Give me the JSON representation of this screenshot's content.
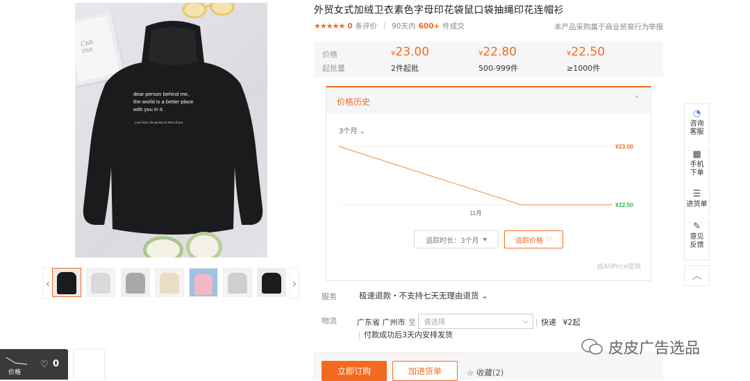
{
  "product": {
    "title": "外贸女式加绒卫衣素色字母印花袋鼠口袋抽绳印花连帽衫",
    "print_text": "dear person behind me,\nthe world is a better place\nwith you in it.",
    "print_small": "Love from, the person in front of you",
    "frame_text": "Cab\nrus"
  },
  "rating": {
    "stars": "★★★★★",
    "review_count": "0",
    "review_label": "条评价",
    "sold_text": "90天内",
    "sold_count": "600+",
    "sold_suffix": "件成交"
  },
  "notice": "本产品采购属于商业贸易行为",
  "report": "举报",
  "price_box": {
    "price_label": "价格",
    "moq_label": "起批量",
    "tiers": [
      {
        "currency": "¥",
        "price": "23.00",
        "qty": "2件起批"
      },
      {
        "currency": "¥",
        "price": "22.80",
        "qty": "500-999件"
      },
      {
        "currency": "¥",
        "price": "22.50",
        "qty": "≥1000件"
      }
    ]
  },
  "history": {
    "title": "价格历史",
    "caret": "⌃",
    "period": "3个月 ⌄",
    "track_label": "追踪时长：3个月",
    "track_caret": "▾",
    "track_price": "追踪价格",
    "credit": "由AliPrice提供"
  },
  "chart_data": {
    "type": "line",
    "x": [
      "",
      "11月",
      ""
    ],
    "series": [
      {
        "values": [
          23.0,
          22.5,
          22.5
        ]
      }
    ],
    "max_label": "¥23.00",
    "min_label": "¥22.50",
    "xlabel": "11月",
    "ylim": [
      22.5,
      23.0
    ],
    "colors": {
      "line": "#f7a161",
      "max": "#f26a21",
      "min": "#2db84d"
    }
  },
  "service": {
    "label": "服务",
    "value": "极速退款・不支持七天无理由退货 ⌄"
  },
  "logistics": {
    "label": "物流",
    "from": "广东省 广州市",
    "to": "至",
    "select_placeholder": "请选择",
    "ship_type": "快递",
    "ship_price": "¥2起",
    "note": "付款成功后3天内安排发货"
  },
  "actions": {
    "buy": "立即订购",
    "cart": "加进货单",
    "fav": "☆ 收藏(2)"
  },
  "sidebar": [
    {
      "icon": "chat-icon",
      "glyph": "◔",
      "label": "咨询\n客服"
    },
    {
      "icon": "qrcode-icon",
      "glyph": "▦",
      "label": "手机\n下单"
    },
    {
      "icon": "list-icon",
      "glyph": "☰",
      "label": "进货单"
    },
    {
      "icon": "edit-icon",
      "glyph": "✎",
      "label": "意见\n反馈"
    }
  ],
  "back_top": "︿",
  "price_widget": {
    "label": "价格",
    "count": "0"
  },
  "watermark": "皮皮广告选品",
  "colors": {
    "accent": "#f26a21",
    "green": "#2db84d"
  }
}
